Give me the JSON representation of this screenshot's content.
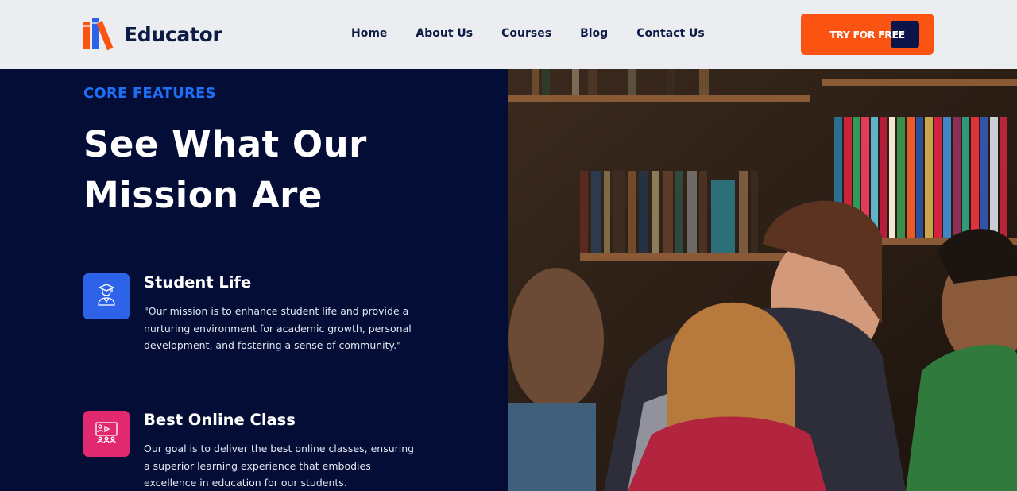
{
  "brand": {
    "name": "Educator"
  },
  "nav": {
    "items": [
      "Home",
      "About Us",
      "Courses",
      "Blog",
      "Contact Us"
    ]
  },
  "cta": {
    "label": "TRY FOR FREE"
  },
  "section": {
    "eyebrow": "CORE FEATURES",
    "heading_line1": "See What Our",
    "heading_line2": "Mission Are"
  },
  "features": [
    {
      "title": "Student Life",
      "description": "\"Our mission is to enhance student life and provide a nurturing environment for academic growth, personal development, and fostering a sense of community.\"",
      "icon": "graduate-icon",
      "color": "#2c63e8"
    },
    {
      "title": "Best Online Class",
      "description": "Our goal is to deliver the best online classes, ensuring a superior learning experience that embodies excellence in education for our students.",
      "icon": "online-class-icon",
      "color": "#e0296e"
    }
  ],
  "colors": {
    "header_bg": "#ebedf0",
    "panel_bg": "#030d36",
    "accent_orange": "#fb5412",
    "accent_blue": "#1e6ff5",
    "navy": "#0b1b45"
  }
}
